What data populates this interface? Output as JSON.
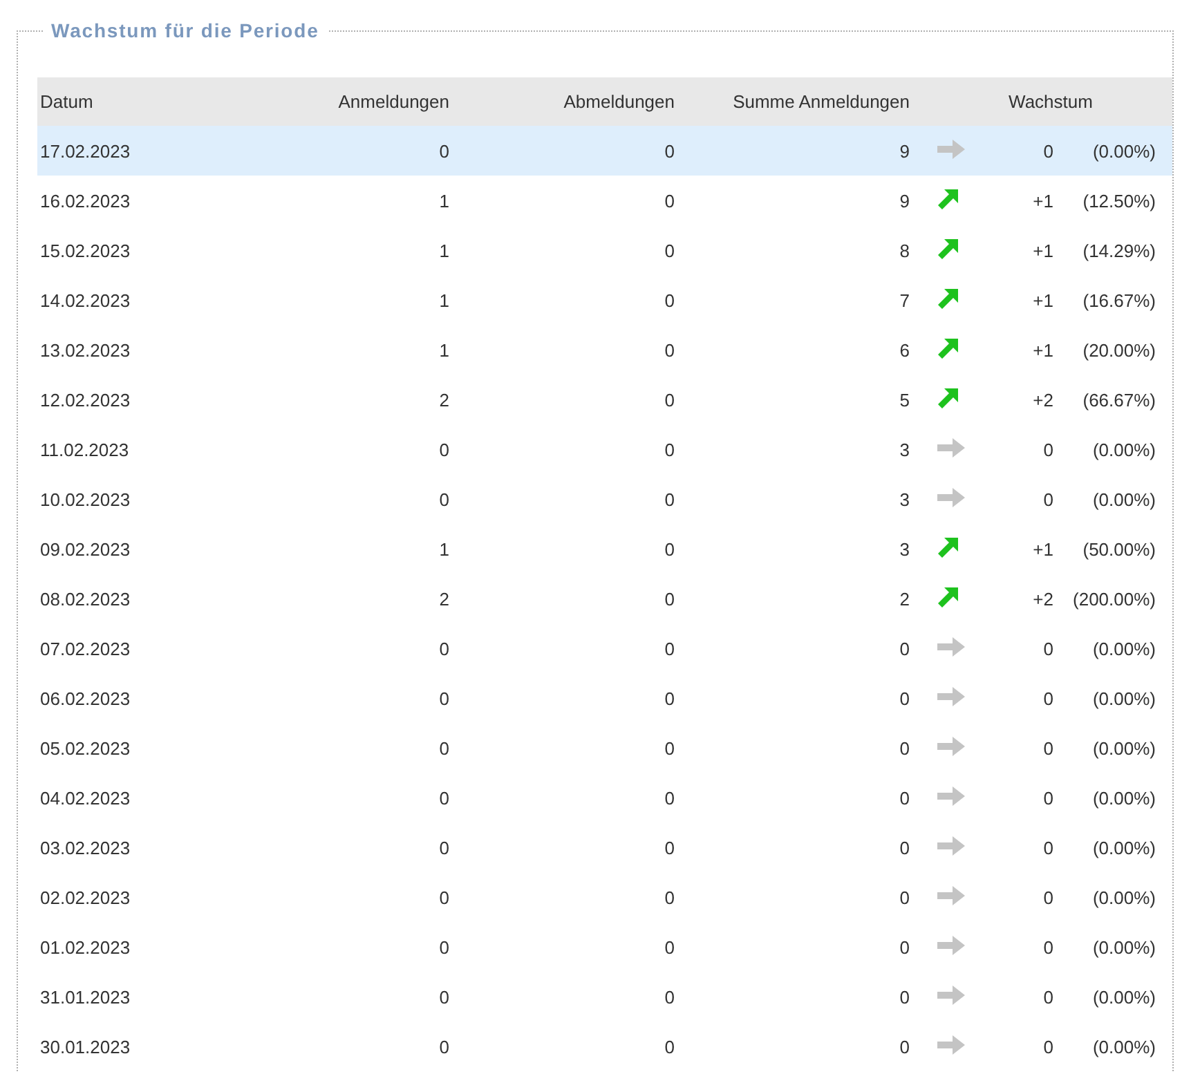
{
  "panel": {
    "title": "Wachstum für die Periode"
  },
  "table": {
    "columns": [
      "Datum",
      "Anmeldungen",
      "Abmeldungen",
      "Summe Anmeldungen",
      "Wachstum"
    ],
    "rows": [
      {
        "date": "17.02.2023",
        "signups": "0",
        "signoffs": "0",
        "total": "9",
        "kind": "flat",
        "growth": "0",
        "percent": "(0.00%)",
        "selected": true
      },
      {
        "date": "16.02.2023",
        "signups": "1",
        "signoffs": "0",
        "total": "9",
        "kind": "up",
        "growth": "+1",
        "percent": "(12.50%)",
        "selected": false
      },
      {
        "date": "15.02.2023",
        "signups": "1",
        "signoffs": "0",
        "total": "8",
        "kind": "up",
        "growth": "+1",
        "percent": "(14.29%)",
        "selected": false
      },
      {
        "date": "14.02.2023",
        "signups": "1",
        "signoffs": "0",
        "total": "7",
        "kind": "up",
        "growth": "+1",
        "percent": "(16.67%)",
        "selected": false
      },
      {
        "date": "13.02.2023",
        "signups": "1",
        "signoffs": "0",
        "total": "6",
        "kind": "up",
        "growth": "+1",
        "percent": "(20.00%)",
        "selected": false
      },
      {
        "date": "12.02.2023",
        "signups": "2",
        "signoffs": "0",
        "total": "5",
        "kind": "up",
        "growth": "+2",
        "percent": "(66.67%)",
        "selected": false
      },
      {
        "date": "11.02.2023",
        "signups": "0",
        "signoffs": "0",
        "total": "3",
        "kind": "flat",
        "growth": "0",
        "percent": "(0.00%)",
        "selected": false
      },
      {
        "date": "10.02.2023",
        "signups": "0",
        "signoffs": "0",
        "total": "3",
        "kind": "flat",
        "growth": "0",
        "percent": "(0.00%)",
        "selected": false
      },
      {
        "date": "09.02.2023",
        "signups": "1",
        "signoffs": "0",
        "total": "3",
        "kind": "up",
        "growth": "+1",
        "percent": "(50.00%)",
        "selected": false
      },
      {
        "date": "08.02.2023",
        "signups": "2",
        "signoffs": "0",
        "total": "2",
        "kind": "up",
        "growth": "+2",
        "percent": "(200.00%)",
        "selected": false
      },
      {
        "date": "07.02.2023",
        "signups": "0",
        "signoffs": "0",
        "total": "0",
        "kind": "flat",
        "growth": "0",
        "percent": "(0.00%)",
        "selected": false
      },
      {
        "date": "06.02.2023",
        "signups": "0",
        "signoffs": "0",
        "total": "0",
        "kind": "flat",
        "growth": "0",
        "percent": "(0.00%)",
        "selected": false
      },
      {
        "date": "05.02.2023",
        "signups": "0",
        "signoffs": "0",
        "total": "0",
        "kind": "flat",
        "growth": "0",
        "percent": "(0.00%)",
        "selected": false
      },
      {
        "date": "04.02.2023",
        "signups": "0",
        "signoffs": "0",
        "total": "0",
        "kind": "flat",
        "growth": "0",
        "percent": "(0.00%)",
        "selected": false
      },
      {
        "date": "03.02.2023",
        "signups": "0",
        "signoffs": "0",
        "total": "0",
        "kind": "flat",
        "growth": "0",
        "percent": "(0.00%)",
        "selected": false
      },
      {
        "date": "02.02.2023",
        "signups": "0",
        "signoffs": "0",
        "total": "0",
        "kind": "flat",
        "growth": "0",
        "percent": "(0.00%)",
        "selected": false
      },
      {
        "date": "01.02.2023",
        "signups": "0",
        "signoffs": "0",
        "total": "0",
        "kind": "flat",
        "growth": "0",
        "percent": "(0.00%)",
        "selected": false
      },
      {
        "date": "31.01.2023",
        "signups": "0",
        "signoffs": "0",
        "total": "0",
        "kind": "flat",
        "growth": "0",
        "percent": "(0.00%)",
        "selected": false
      },
      {
        "date": "30.01.2023",
        "signups": "0",
        "signoffs": "0",
        "total": "0",
        "kind": "flat",
        "growth": "0",
        "percent": "(0.00%)",
        "selected": false
      }
    ]
  }
}
